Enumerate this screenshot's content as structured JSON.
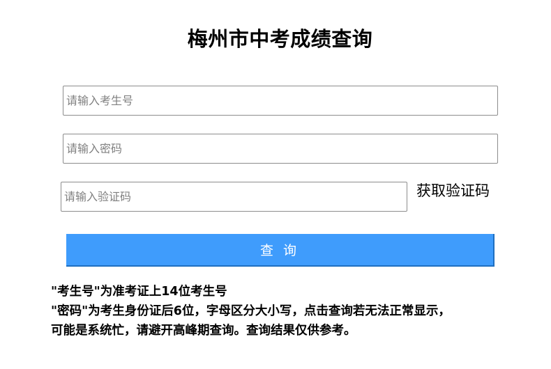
{
  "page": {
    "title": "梅州市中考成绩查询"
  },
  "form": {
    "exam_number_placeholder": "请输入考生号",
    "password_placeholder": "请输入密码",
    "captcha_placeholder": "请输入验证码",
    "get_captcha_label": "获取验证码",
    "query_button_label": "查 询"
  },
  "notes": {
    "line1": "\"考生号\"为准考证上14位考生号",
    "line2": "\"密码\"为考生身份证后6位，字母区分大小写，点击查询若无法正常显示，",
    "line3": "可能是系统忙，请避开高峰期查询。查询结果仅供参考。"
  },
  "colors": {
    "button_bg": "#3f9cfc",
    "button_text": "#ffffff",
    "input_border": "#8c8c8c",
    "placeholder": "#808080"
  }
}
